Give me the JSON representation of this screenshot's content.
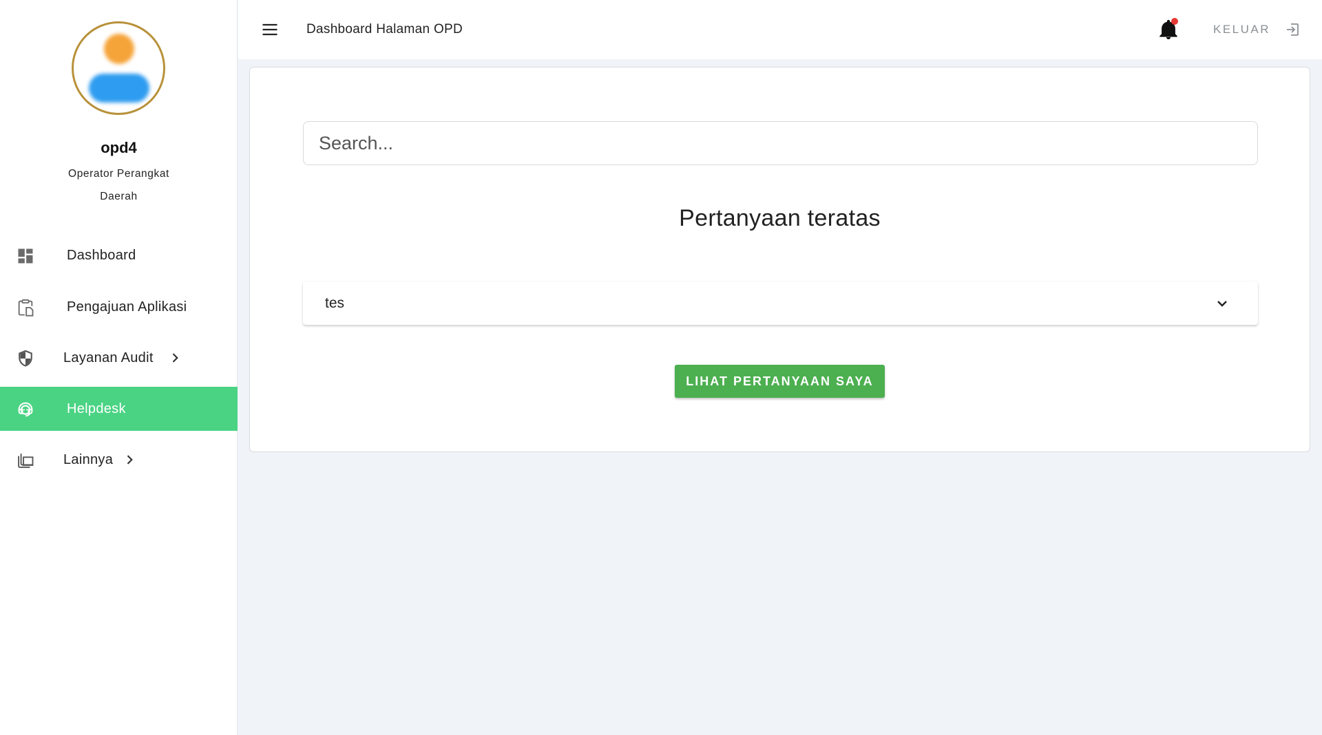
{
  "sidebar": {
    "user": {
      "name": "opd4",
      "role": "Operator Perangkat Daerah"
    },
    "items": [
      {
        "label": "Dashboard",
        "icon": "dashboard-icon",
        "active": false
      },
      {
        "label": "Pengajuan Aplikasi",
        "icon": "clipboard-icon",
        "active": false
      },
      {
        "label": "Layanan Audit",
        "icon": "shield-icon",
        "active": false,
        "expandable": true
      },
      {
        "label": "Helpdesk",
        "icon": "support-agent-icon",
        "active": true
      },
      {
        "label": "Lainnya",
        "icon": "library-icon",
        "active": false,
        "expandable": true
      }
    ]
  },
  "topbar": {
    "title": "Dashboard Halaman OPD",
    "logout_label": "KELUAR",
    "has_notification": true
  },
  "main": {
    "search_placeholder": "Search...",
    "section_title": "Pertanyaan teratas",
    "faq_items": [
      {
        "question": "tes"
      }
    ],
    "primary_button_label": "LIHAT PERTANYAAN SAYA"
  },
  "colors": {
    "accent_green": "#4ad383",
    "button_green": "#4caf50",
    "avatar_ring": "#b8913a",
    "notification_dot": "#e53935",
    "background": "#f0f4f8"
  }
}
